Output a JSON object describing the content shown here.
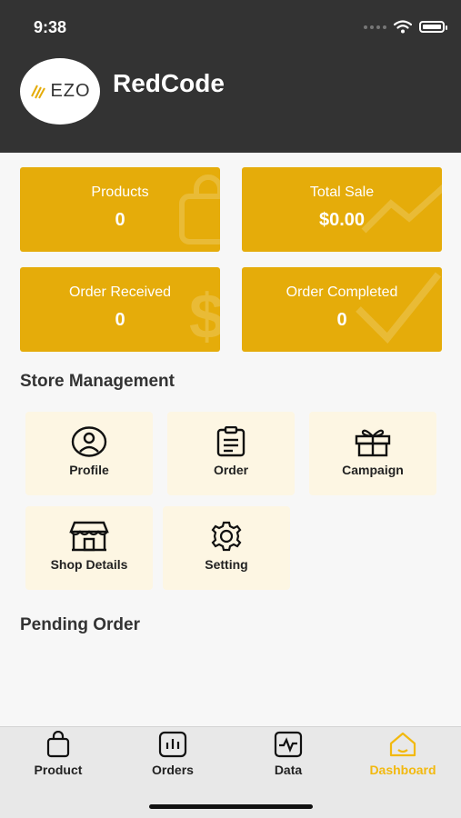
{
  "status_bar": {
    "time": "9:38"
  },
  "header": {
    "logo_text": "EZO",
    "store_name": "RedCode"
  },
  "stats": [
    {
      "label": "Products",
      "value": "0"
    },
    {
      "label": "Total Sale",
      "value": "$0.00"
    },
    {
      "label": "Order Received",
      "value": "0"
    },
    {
      "label": "Order Completed",
      "value": "0"
    }
  ],
  "store_management": {
    "title": "Store Management",
    "items": [
      {
        "label": "Profile",
        "icon": "profile-icon"
      },
      {
        "label": "Order",
        "icon": "clipboard-icon"
      },
      {
        "label": "Campaign",
        "icon": "gift-icon"
      },
      {
        "label": "Shop Details",
        "icon": "shop-icon"
      },
      {
        "label": "Setting",
        "icon": "gear-icon"
      }
    ]
  },
  "pending_order": {
    "title": "Pending Order"
  },
  "tabbar": {
    "items": [
      {
        "label": "Product",
        "icon": "bag-icon"
      },
      {
        "label": "Orders",
        "icon": "bar-chart-icon"
      },
      {
        "label": "Data",
        "icon": "pulse-icon"
      },
      {
        "label": "Dashboard",
        "icon": "home-icon"
      }
    ],
    "active": "Dashboard"
  },
  "colors": {
    "header_bg": "#333333",
    "card_bg": "#e5ac0a",
    "tile_bg": "#fdf6e3",
    "accent": "#f2b90f"
  }
}
